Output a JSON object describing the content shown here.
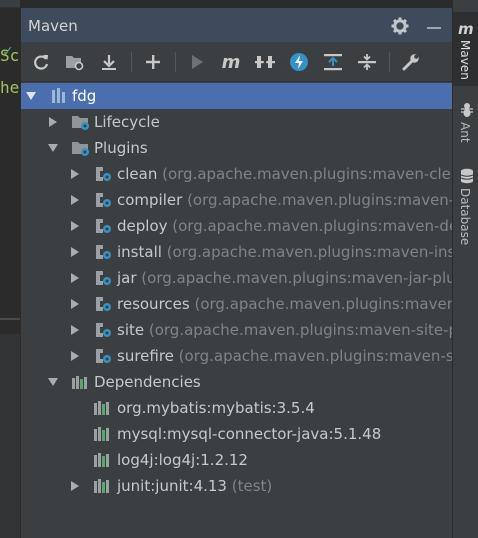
{
  "panel": {
    "title": "Maven"
  },
  "editor": {
    "line1": "Sc",
    "line2": "he"
  },
  "toolbar": {
    "m_glyph": "m"
  },
  "tree": {
    "root": {
      "label": "fdg"
    },
    "lifecycle": {
      "label": "Lifecycle"
    },
    "plugins": {
      "label": "Plugins",
      "items": [
        {
          "name": "clean",
          "artifact": " (org.apache.maven.plugins:maven-clean-pl"
        },
        {
          "name": "compiler",
          "artifact": " (org.apache.maven.plugins:maven-com"
        },
        {
          "name": "deploy",
          "artifact": " (org.apache.maven.plugins:maven-deploy"
        },
        {
          "name": "install",
          "artifact": " (org.apache.maven.plugins:maven-install-p"
        },
        {
          "name": "jar",
          "artifact": " (org.apache.maven.plugins:maven-jar-plugin:"
        },
        {
          "name": "resources",
          "artifact": " (org.apache.maven.plugins:maven-reso"
        },
        {
          "name": "site",
          "artifact": " (org.apache.maven.plugins:maven-site-plugi"
        },
        {
          "name": "surefire",
          "artifact": " (org.apache.maven.plugins:maven-surefi"
        }
      ]
    },
    "dependencies": {
      "label": "Dependencies",
      "items": [
        {
          "name": "org.mybatis:mybatis:3.5.4",
          "scope": ""
        },
        {
          "name": "mysql:mysql-connector-java:5.1.48",
          "scope": ""
        },
        {
          "name": "log4j:log4j:1.2.12",
          "scope": ""
        },
        {
          "name": "junit:junit:4.13",
          "scope": " (test)"
        }
      ]
    }
  },
  "stripe": {
    "maven": "Maven",
    "ant": "Ant",
    "database": "Database"
  },
  "colors": {
    "selection": "#4b6eaf",
    "header": "#3d4b5c",
    "panel": "#3c3f41",
    "accent_blue": "#3592c4"
  }
}
